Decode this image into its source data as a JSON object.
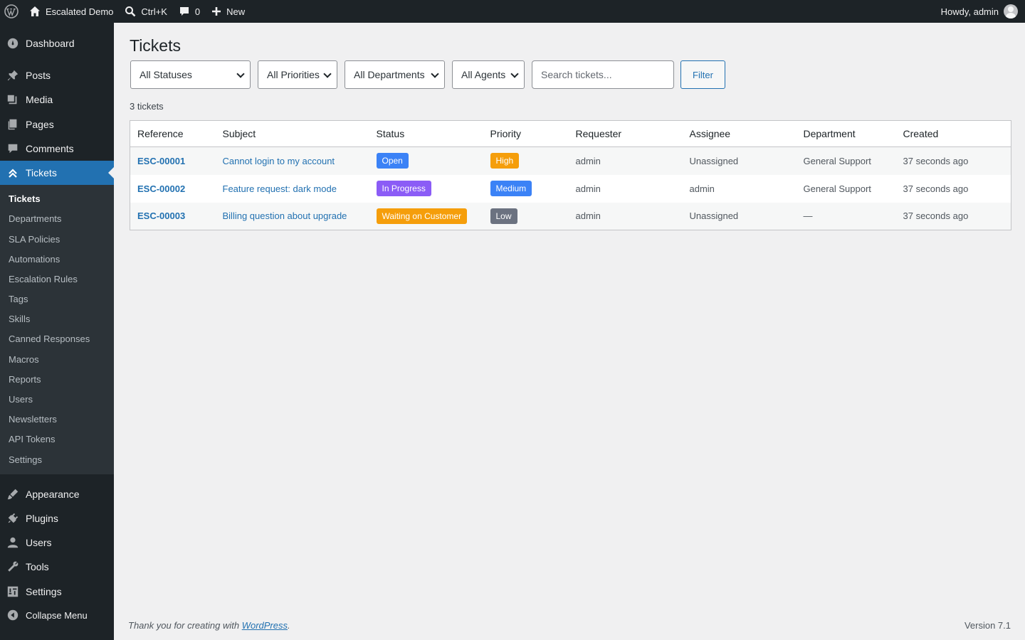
{
  "adminbar": {
    "site_name": "Escalated Demo",
    "search_shortcut": "Ctrl+K",
    "comments_count": "0",
    "new_label": "New",
    "greeting": "Howdy, admin"
  },
  "menu": {
    "dashboard": "Dashboard",
    "posts": "Posts",
    "media": "Media",
    "pages": "Pages",
    "comments": "Comments",
    "tickets": "Tickets",
    "appearance": "Appearance",
    "plugins": "Plugins",
    "users": "Users",
    "tools": "Tools",
    "settings": "Settings",
    "collapse": "Collapse Menu"
  },
  "submenu": [
    "Tickets",
    "Departments",
    "SLA Policies",
    "Automations",
    "Escalation Rules",
    "Tags",
    "Skills",
    "Canned Responses",
    "Macros",
    "Reports",
    "Users",
    "Newsletters",
    "API Tokens",
    "Settings"
  ],
  "page": {
    "title": "Tickets",
    "filters": {
      "status": "All Statuses",
      "priority": "All Priorities",
      "department": "All Departments",
      "agent": "All Agents",
      "search_placeholder": "Search tickets...",
      "filter_button": "Filter"
    },
    "count_label": "3 tickets",
    "columns": [
      "Reference",
      "Subject",
      "Status",
      "Priority",
      "Requester",
      "Assignee",
      "Department",
      "Created"
    ],
    "rows": [
      {
        "reference": "ESC-00001",
        "subject": "Cannot login to my account",
        "status": "Open",
        "status_color": "#3b82f6",
        "priority": "High",
        "priority_color": "#f59e0b",
        "requester": "admin",
        "assignee": "Unassigned",
        "department": "General Support",
        "created": "37 seconds ago"
      },
      {
        "reference": "ESC-00002",
        "subject": "Feature request: dark mode",
        "status": "In Progress",
        "status_color": "#8b5cf6",
        "priority": "Medium",
        "priority_color": "#3b82f6",
        "requester": "admin",
        "assignee": "admin",
        "department": "General Support",
        "created": "37 seconds ago"
      },
      {
        "reference": "ESC-00003",
        "subject": "Billing question about upgrade",
        "status": "Waiting on Customer",
        "status_color": "#f59e0b",
        "priority": "Low",
        "priority_color": "#6b7280",
        "requester": "admin",
        "assignee": "Unassigned",
        "department": "—",
        "created": "37 seconds ago"
      }
    ]
  },
  "footer": {
    "thanks_prefix": "Thank you for creating with ",
    "thanks_link": "WordPress",
    "thanks_suffix": ".",
    "version": "Version 7.1"
  }
}
